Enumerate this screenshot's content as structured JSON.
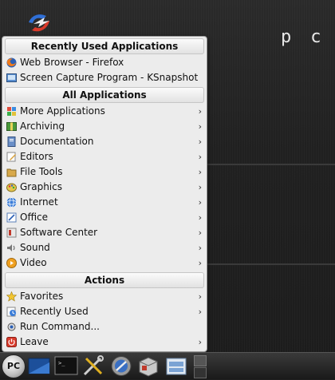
{
  "desktop": {
    "brand_text": "pc",
    "logo_icon": "pclinuxos-logo-icon"
  },
  "menu": {
    "recent_apps_header": "Recently Used Applications",
    "recent_apps": [
      {
        "label": "Web Browser - Firefox",
        "icon": "firefox-icon"
      },
      {
        "label": "Screen Capture Program - KSnapshot",
        "icon": "ksnapshot-icon"
      }
    ],
    "all_apps_header": "All Applications",
    "all_apps": [
      {
        "label": "More Applications",
        "icon": "more-apps-icon"
      },
      {
        "label": "Archiving",
        "icon": "archiving-icon"
      },
      {
        "label": "Documentation",
        "icon": "documentation-icon"
      },
      {
        "label": "Editors",
        "icon": "editors-icon"
      },
      {
        "label": "File Tools",
        "icon": "file-tools-icon"
      },
      {
        "label": "Graphics",
        "icon": "graphics-icon"
      },
      {
        "label": "Internet",
        "icon": "internet-icon"
      },
      {
        "label": "Office",
        "icon": "office-icon"
      },
      {
        "label": "Software Center",
        "icon": "software-center-icon"
      },
      {
        "label": "Sound",
        "icon": "sound-icon"
      },
      {
        "label": "Video",
        "icon": "video-icon"
      }
    ],
    "actions_header": "Actions",
    "actions": [
      {
        "label": "Favorites",
        "icon": "favorites-icon",
        "submenu": true
      },
      {
        "label": "Recently Used",
        "icon": "recently-used-icon",
        "submenu": true
      },
      {
        "label": "Run Command...",
        "icon": "run-command-icon",
        "submenu": false
      },
      {
        "label": "Leave",
        "icon": "leave-icon",
        "submenu": true
      }
    ],
    "submenu_arrow": "›"
  },
  "taskbar": {
    "start_button_label": "PC",
    "launchers": [
      {
        "icon": "desktop-show-icon"
      },
      {
        "icon": "terminal-icon",
        "glyph": ">_"
      },
      {
        "icon": "tools-icon"
      },
      {
        "icon": "control-center-icon"
      },
      {
        "icon": "package-manager-icon"
      },
      {
        "icon": "file-manager-icon"
      }
    ]
  }
}
